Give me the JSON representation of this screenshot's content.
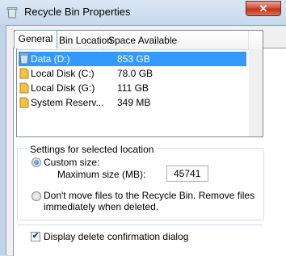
{
  "window": {
    "title": "Recycle Bin Properties",
    "close_glyph": "✕"
  },
  "tabs": [
    {
      "label": "General"
    }
  ],
  "list": {
    "columns": {
      "location": "Recycle Bin Location",
      "space": "Space Available"
    },
    "rows": [
      {
        "location": "Data (D:)",
        "space": "853 GB",
        "icon": "recycle-bin-icon",
        "selected": true
      },
      {
        "location": "Local Disk (C:)",
        "space": "78.0 GB",
        "icon": "folder-icon",
        "selected": false
      },
      {
        "location": "Local Disk (G:)",
        "space": "111 GB",
        "icon": "folder-icon",
        "selected": false
      },
      {
        "location": "System Reserv...",
        "space": "349 MB",
        "icon": "folder-icon",
        "selected": false
      }
    ]
  },
  "settings": {
    "legend": "Settings for selected location",
    "custom_size_label": "Custom size:",
    "max_size_label": "Maximum size (MB):",
    "max_size_value": "45741",
    "dont_move_line1": "Don't move files to the Recycle Bin. Remove files",
    "dont_move_line2": "immediately when deleted.",
    "selected_option": "custom_size"
  },
  "confirm_checkbox": {
    "label": "Display delete confirmation dialog",
    "checked": true,
    "glyph": "✔"
  },
  "colors": {
    "selection": "#3399ff",
    "close_button": "#c8402d"
  }
}
